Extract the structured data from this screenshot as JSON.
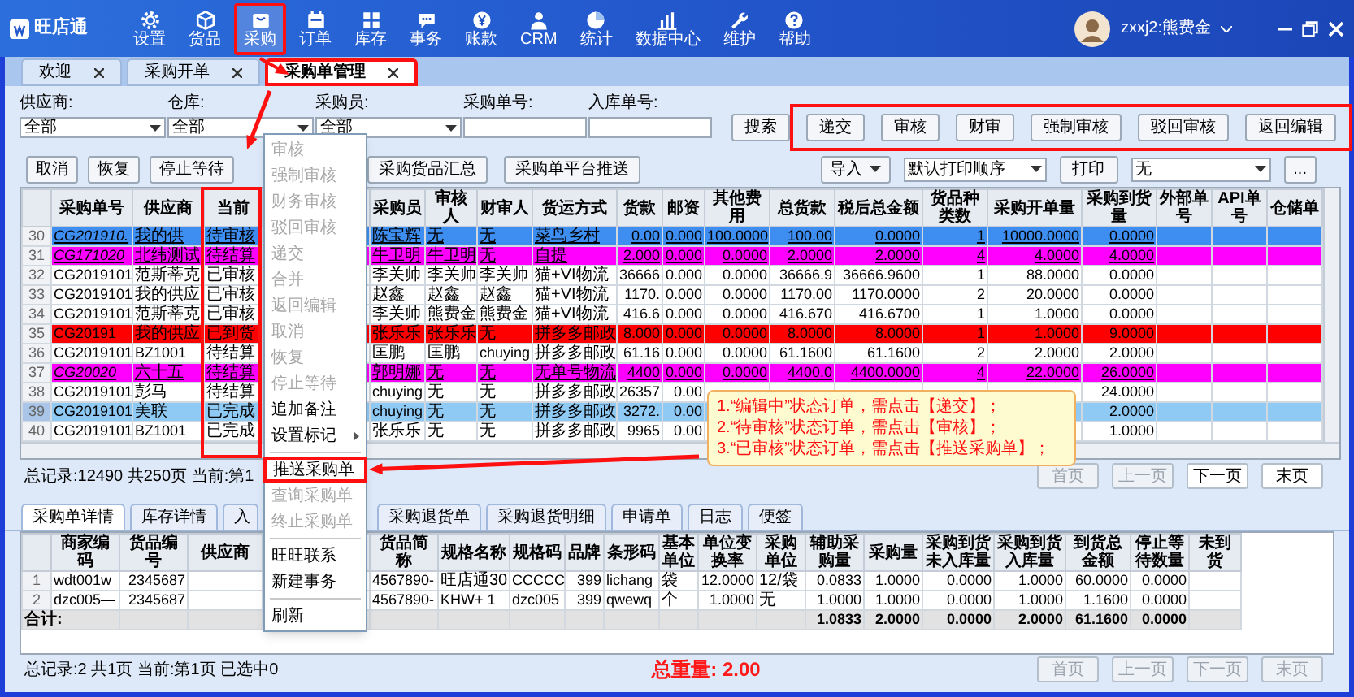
{
  "app": {
    "logo": "旺店通",
    "user": "zxxj2:熊费金",
    "nav": [
      {
        "label": "设置",
        "selected": false
      },
      {
        "label": "货品",
        "selected": false
      },
      {
        "label": "采购",
        "selected": true
      },
      {
        "label": "订单",
        "selected": false
      },
      {
        "label": "库存",
        "selected": false
      },
      {
        "label": "事务",
        "selected": false
      },
      {
        "label": "账款",
        "selected": false
      },
      {
        "label": "CRM",
        "selected": false
      },
      {
        "label": "统计",
        "selected": false
      },
      {
        "label": "数据中心",
        "selected": false
      },
      {
        "label": "维护",
        "selected": false
      },
      {
        "label": "帮助",
        "selected": false
      }
    ]
  },
  "tabs": [
    {
      "label": "欢迎",
      "selected": false
    },
    {
      "label": "采购开单",
      "selected": false
    },
    {
      "label": "采购单管理",
      "selected": true
    }
  ],
  "filters": [
    {
      "label": "供应商:",
      "kind": "select",
      "value": "全部"
    },
    {
      "label": "仓库:",
      "kind": "select",
      "value": "全部"
    },
    {
      "label": "采购员:",
      "kind": "select",
      "value": "全部"
    },
    {
      "label": "采购单号:",
      "kind": "text"
    },
    {
      "label": "入库单号:",
      "kind": "text"
    }
  ],
  "search_button": "搜索",
  "action_buttons": [
    "递交",
    "审核",
    "财审",
    "强制审核",
    "驳回审核",
    "返回编辑"
  ],
  "toolbar_left": [
    "取消",
    "恢复",
    "停止等待"
  ],
  "toolbar_middle": [
    "采购货品汇总",
    "采购单平台推送"
  ],
  "toolbar_right": {
    "import": "导入",
    "print_order": "默认打印顺序",
    "print": "打印",
    "template": "无",
    "more": "..."
  },
  "orders_table": {
    "columns": [
      "采购单号",
      "供应商",
      "当前",
      "采购员",
      "审核人",
      "财审人",
      "货运方式",
      "货款",
      "邮资",
      "其他费用",
      "总货款",
      "税后总金额",
      "货品种类数",
      "采购开单量",
      "采购到货量",
      "外部单号",
      "API单号",
      "仓储单"
    ],
    "rows": [
      {
        "number": "30",
        "selected": false,
        "underlined": true,
        "color": "#3d8ef0",
        "cells": [
          "CG201910.",
          "我的供",
          "待审核",
          "陈宝辉",
          "无",
          "无",
          "菜鸟乡村",
          "0.00",
          "0.000",
          "100.0000",
          "100.00",
          "0.0000",
          "1",
          "10000.0000",
          "0.0000"
        ]
      },
      {
        "number": "31",
        "selected": false,
        "underlined": true,
        "color": "#ff00ff",
        "cells": [
          "CG171020",
          "北纬测试",
          "待结算",
          "牛卫明",
          "牛卫明",
          "无",
          "自提",
          "2.000",
          "0.000",
          "0.0000",
          "2.0000",
          "2.0000",
          "4",
          "4.0000",
          "4.0000"
        ]
      },
      {
        "number": "32",
        "selected": false,
        "underlined": false,
        "cells": [
          "CG2019101",
          "范斯蒂克",
          "已审核",
          "李关帅",
          "李关帅",
          "李关帅",
          "猫+VI物流",
          "36666",
          "0.000",
          "0.0000",
          "36666.9",
          "36666.9600",
          "1",
          "88.0000",
          "0.0000"
        ]
      },
      {
        "number": "33",
        "selected": false,
        "underlined": false,
        "cells": [
          "CG2019101",
          "我的供应",
          "已审核",
          "赵鑫",
          "赵鑫",
          "赵鑫",
          "猫+VI物流",
          "1170.",
          "0.000",
          "0.0000",
          "1170.00",
          "1170.0000",
          "2",
          "20.0000",
          "0.0000"
        ]
      },
      {
        "number": "34",
        "selected": false,
        "underlined": false,
        "cells": [
          "CG2019101",
          "范斯蒂克",
          "已审核",
          "李关帅",
          "熊费金",
          "熊费金",
          "猫+VI物流",
          "416.6",
          "0.000",
          "0.0000",
          "416.670",
          "416.6700",
          "1",
          "1.0000",
          "0.0000"
        ]
      },
      {
        "number": "35",
        "selected": false,
        "underlined": false,
        "color": "#ff0000",
        "cells": [
          "CG20191",
          "我的供应",
          "已到货",
          "张乐乐",
          "张乐乐",
          "无",
          "拼多多邮政",
          "8.000",
          "0.000",
          "0.0000",
          "8.0000",
          "8.0000",
          "1",
          "1.0000",
          "9.0000"
        ]
      },
      {
        "number": "36",
        "selected": false,
        "underlined": false,
        "cells": [
          "CG2019101",
          "BZ1001",
          "待结算",
          "匡鹏",
          "匡鹏",
          "chuying",
          "拼多多邮政",
          "61.16",
          "0.000",
          "0.0000",
          "61.1600",
          "61.1600",
          "2",
          "2.0000",
          "2.0000"
        ]
      },
      {
        "number": "37",
        "selected": false,
        "underlined": true,
        "color": "#ff00ff",
        "cells": [
          "CG20020",
          "六十五",
          "待结算",
          "郭明娜",
          "无",
          "无",
          "无单号物流",
          "4400",
          "0.000",
          "0.0000",
          "4400.0",
          "4400.0000",
          "4",
          "22.0000",
          "26.0000"
        ]
      },
      {
        "number": "38",
        "selected": false,
        "underlined": false,
        "cells": [
          "CG2019101",
          "彭马",
          "待结算",
          "chuying",
          "无",
          "无",
          "拼多多邮政",
          "26357",
          "0.00",
          null,
          null,
          null,
          null,
          null,
          "24.0000"
        ]
      },
      {
        "number": "39",
        "selected": true,
        "underlined": false,
        "cells": [
          "CG2019101",
          "美联",
          "已完成",
          "chuying",
          "无",
          "无",
          "拼多多邮政",
          "3272.",
          "0.00",
          null,
          null,
          null,
          null,
          null,
          "2.0000"
        ]
      },
      {
        "number": "40",
        "selected": false,
        "underlined": false,
        "cells": [
          "CG2019101",
          "BZ1001",
          "已完成",
          "张乐乐",
          "无",
          "无",
          "拼多多邮政",
          "9965",
          "0.00",
          null,
          null,
          null,
          null,
          null,
          "1.0000"
        ]
      }
    ]
  },
  "orders_status": "总记录:12490 共250页 当前:第1",
  "pager": [
    {
      "label": "首页",
      "disabled": true
    },
    {
      "label": "上一页",
      "disabled": true
    },
    {
      "label": "下一页",
      "disabled": false
    },
    {
      "label": "末页",
      "disabled": false
    }
  ],
  "callout": [
    "1.“编辑中”状态订单，需点击【递交】；",
    "2.“待审核”状态订单，需点击【审核】；",
    "3.“已审核”状态订单，需点击【推送采购单】；"
  ],
  "context_menu": [
    {
      "kind": "item",
      "label": "审核",
      "disabled": true,
      "submenu": false,
      "highlighted": false
    },
    {
      "kind": "item",
      "label": "强制审核",
      "disabled": true,
      "submenu": false,
      "highlighted": false
    },
    {
      "kind": "item",
      "label": "财务审核",
      "disabled": true,
      "submenu": false,
      "highlighted": false
    },
    {
      "kind": "item",
      "label": "驳回审核",
      "disabled": true,
      "submenu": false,
      "highlighted": false
    },
    {
      "kind": "item",
      "label": "递交",
      "disabled": true,
      "submenu": false,
      "highlighted": false
    },
    {
      "kind": "item",
      "label": "合并",
      "disabled": true,
      "submenu": false,
      "highlighted": false
    },
    {
      "kind": "item",
      "label": "返回编辑",
      "disabled": true,
      "submenu": false,
      "highlighted": false
    },
    {
      "kind": "item",
      "label": "取消",
      "disabled": true,
      "submenu": false,
      "highlighted": false
    },
    {
      "kind": "item",
      "label": "恢复",
      "disabled": true,
      "submenu": false,
      "highlighted": false
    },
    {
      "kind": "item",
      "label": "停止等待",
      "disabled": true,
      "submenu": false,
      "highlighted": false
    },
    {
      "kind": "item",
      "label": "追加备注",
      "disabled": false,
      "submenu": false,
      "highlighted": false
    },
    {
      "kind": "item",
      "label": "设置标记",
      "disabled": false,
      "submenu": true,
      "highlighted": false
    },
    {
      "kind": "separator"
    },
    {
      "kind": "item",
      "label": "推送采购单",
      "disabled": false,
      "submenu": false,
      "highlighted": true
    },
    {
      "kind": "item",
      "label": "查询采购单",
      "disabled": true,
      "submenu": false,
      "highlighted": false
    },
    {
      "kind": "item",
      "label": "终止采购单",
      "disabled": true,
      "submenu": false,
      "highlighted": false
    },
    {
      "kind": "separator"
    },
    {
      "kind": "item",
      "label": "旺旺联系",
      "disabled": false,
      "submenu": false,
      "highlighted": false
    },
    {
      "kind": "item",
      "label": "新建事务",
      "disabled": false,
      "submenu": false,
      "highlighted": false
    },
    {
      "kind": "separator"
    },
    {
      "kind": "item",
      "label": "刷新",
      "disabled": false,
      "submenu": false,
      "highlighted": false
    }
  ],
  "detail_tabs_left": [
    {
      "label": "采购单详情",
      "selected": true
    },
    {
      "label": "库存详情",
      "selected": false
    },
    {
      "label": "入",
      "selected": false
    }
  ],
  "detail_tabs_right": [
    {
      "label": "采购退货单",
      "selected": false
    },
    {
      "label": "采购退货明细",
      "selected": false
    },
    {
      "label": "申请单",
      "selected": false
    },
    {
      "label": "日志",
      "selected": false
    },
    {
      "label": "便签",
      "selected": false
    }
  ],
  "detail_table": {
    "columns": [
      "商家编码",
      "货品编号",
      "供应商",
      "货品简称",
      "规格名称",
      "规格码",
      "品牌",
      "条形码",
      "基本单位",
      "单位变换率",
      "采购单位",
      "辅助采购量",
      "采购量",
      "采购到货未入库量",
      "采购到货入库量",
      "到货总金额",
      "停止等待数量",
      "未到货"
    ],
    "rows": [
      {
        "number": "1",
        "cells": [
          "wdt001w",
          "2345687",
          null,
          "4567890-",
          "旺店通30",
          "CCCCC",
          "399",
          "lichang",
          "袋",
          "12.0000",
          "12/袋",
          "0.0833",
          "1.0000",
          "0.0000",
          "1.0000",
          "60.0000",
          "0.0000"
        ]
      },
      {
        "number": "2",
        "cells": [
          "dzc005—",
          "2345687",
          null,
          "4567890-",
          "KHW+ 1",
          "dzc005",
          "399",
          "qwewq",
          "个",
          "1.0000",
          "无",
          "1.0000",
          "1.0000",
          "0.0000",
          "1.0000",
          "1.1600",
          "0.0000"
        ]
      }
    ],
    "total": {
      "label": "合计:",
      "cells": [
        null,
        null,
        null,
        null,
        null,
        null,
        null,
        null,
        null,
        null,
        null,
        "1.0833",
        "2.0000",
        "0.0000",
        "2.0000",
        "61.1600",
        "0.0000"
      ]
    }
  },
  "detail_status": "总记录:2 共1页 当前:第1页 已选中0",
  "total_weight": "总重量: 2.00",
  "detail_pager": [
    {
      "label": "首页",
      "disabled": true
    },
    {
      "label": "上一页",
      "disabled": true
    },
    {
      "label": "下一页",
      "disabled": true
    },
    {
      "label": "末页",
      "disabled": true
    }
  ]
}
